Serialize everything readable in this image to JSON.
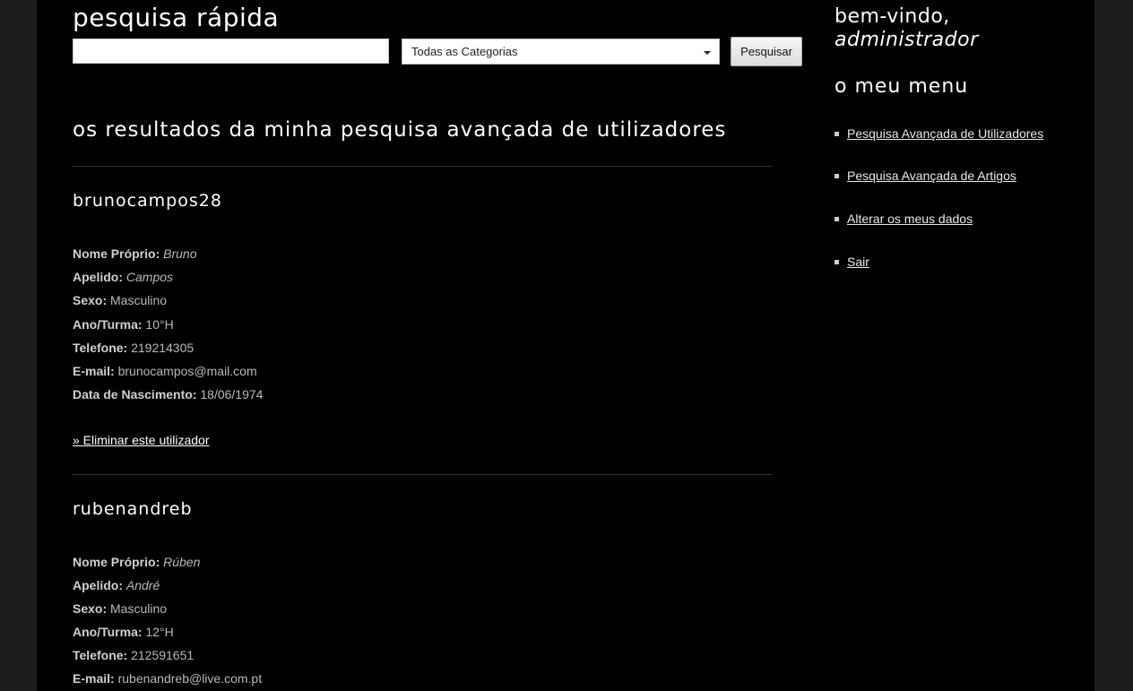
{
  "quick_search": {
    "title": "pesquisa rápida",
    "input_value": "",
    "category_selected": "Todas as Categorias",
    "button_label": "Pesquisar"
  },
  "results": {
    "title": "os resultados da minha pesquisa avançada de utilizadores",
    "users": [
      {
        "username": "brunocampos28",
        "fields": [
          {
            "label": "Nome Próprio:",
            "value": "Bruno"
          },
          {
            "label": "Apelido:",
            "value": "Campos"
          },
          {
            "label": "Sexo:",
            "value": "Masculino"
          },
          {
            "label": "Ano/Turma:",
            "value": "10°H"
          },
          {
            "label": "Telefone:",
            "value": "219214305"
          },
          {
            "label": "E-mail:",
            "value": "brunocampos@mail.com"
          },
          {
            "label": "Data de Nascimento:",
            "value": "18/06/1974"
          }
        ],
        "delete_label": "» Eliminar este utilizador"
      },
      {
        "username": "rubenandreb",
        "fields": [
          {
            "label": "Nome Próprio:",
            "value": "Rúben"
          },
          {
            "label": "Apelido:",
            "value": "André"
          },
          {
            "label": "Sexo:",
            "value": "Masculino"
          },
          {
            "label": "Ano/Turma:",
            "value": "12°H"
          },
          {
            "label": "Telefone:",
            "value": "212591651"
          },
          {
            "label": "E-mail:",
            "value": "rubenandreb@live.com.pt"
          }
        ]
      }
    ]
  },
  "sidebar": {
    "welcome": "bem-vindo,",
    "username": "administrador",
    "menu_title": "o meu menu",
    "menu_items": [
      {
        "label": "Pesquisa Avançada de Utilizadores"
      },
      {
        "label": "Pesquisa Avançada de Artigos"
      },
      {
        "label": "Alterar os meus dados"
      },
      {
        "label": "Sair"
      }
    ]
  },
  "colors": {
    "page_background": "#000000",
    "outer_background": "#1c1c1c",
    "heading_text": "#ffffff",
    "body_text": "#b8b8b8"
  }
}
